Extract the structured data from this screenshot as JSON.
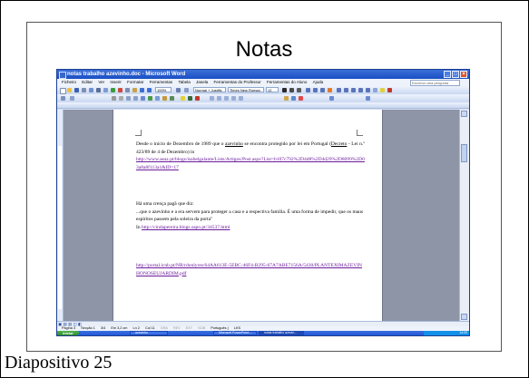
{
  "slide": {
    "title": "Notas",
    "caption": "Diapositivo 25"
  },
  "word": {
    "title": "notas trabalho azevinho.doc - Microsoft Word",
    "menu": [
      "Ficheiro",
      "Editar",
      "Ver",
      "Inserir",
      "Formatar",
      "Ferramentas",
      "Tabela",
      "Janela",
      "Ferramentas do Professor",
      "Ferramentas do Aluno",
      "Ajuda"
    ],
    "help_placeholder": "Escreva uma pergunta",
    "zoom": "100%",
    "style": "Normal + Justific",
    "font": "Times New Roman",
    "size": "12"
  },
  "document": {
    "p1_a": "Desde o início de Dezembro de 1989 que o ",
    "p1_link_word": "azevinho",
    "p1_b": " se encontra protegido por lei em Portugal (",
    "p1_decreto": "Decreto",
    "p1_c": " - Lei n.º 423/89 de 4 de Dezembro) in ",
    "p1_url": "http://www.aeaz.pt/blogs/isabelgalante/Lists/Artigos/Post.aspx?List=b107c792%2D4d8%2D4d29%2D8099%2D03a8a8f113a1&ID=17",
    "p2_a": "Há uma crença pagã que diz:",
    "p2_b": "...que o azevinho e a era servem para proteger a casa e a respectiva família. É uma forma de impedir, que os maus espíritos passem pela soleira da porta\"",
    "p2_in": "In ",
    "p2_url": "http://cindapereira.blogs.sapo.pt/34537.html",
    "p3_url": "http://portal.icnb.pt/NR/rdonlyres/64AA613E-5EBC-46F4-B295-67A7ABE7156A/5430/PLANTEXIMAZEVINHONOSEUJARDIM.pdf"
  },
  "status": {
    "items": [
      "Página 3",
      "Secção 1",
      "3/4",
      "Em 3,2 cm",
      "Ln 2",
      "Col 11",
      "GRA",
      "REV",
      "EXT",
      "SOB",
      "Português (",
      "LKS"
    ]
  },
  "taskbar": {
    "start": "Iniciar",
    "tasks": [
      "azevinho",
      "Microsoft PowerPoint...",
      "notas trabalho azevin..."
    ],
    "clock": "14:09"
  }
}
